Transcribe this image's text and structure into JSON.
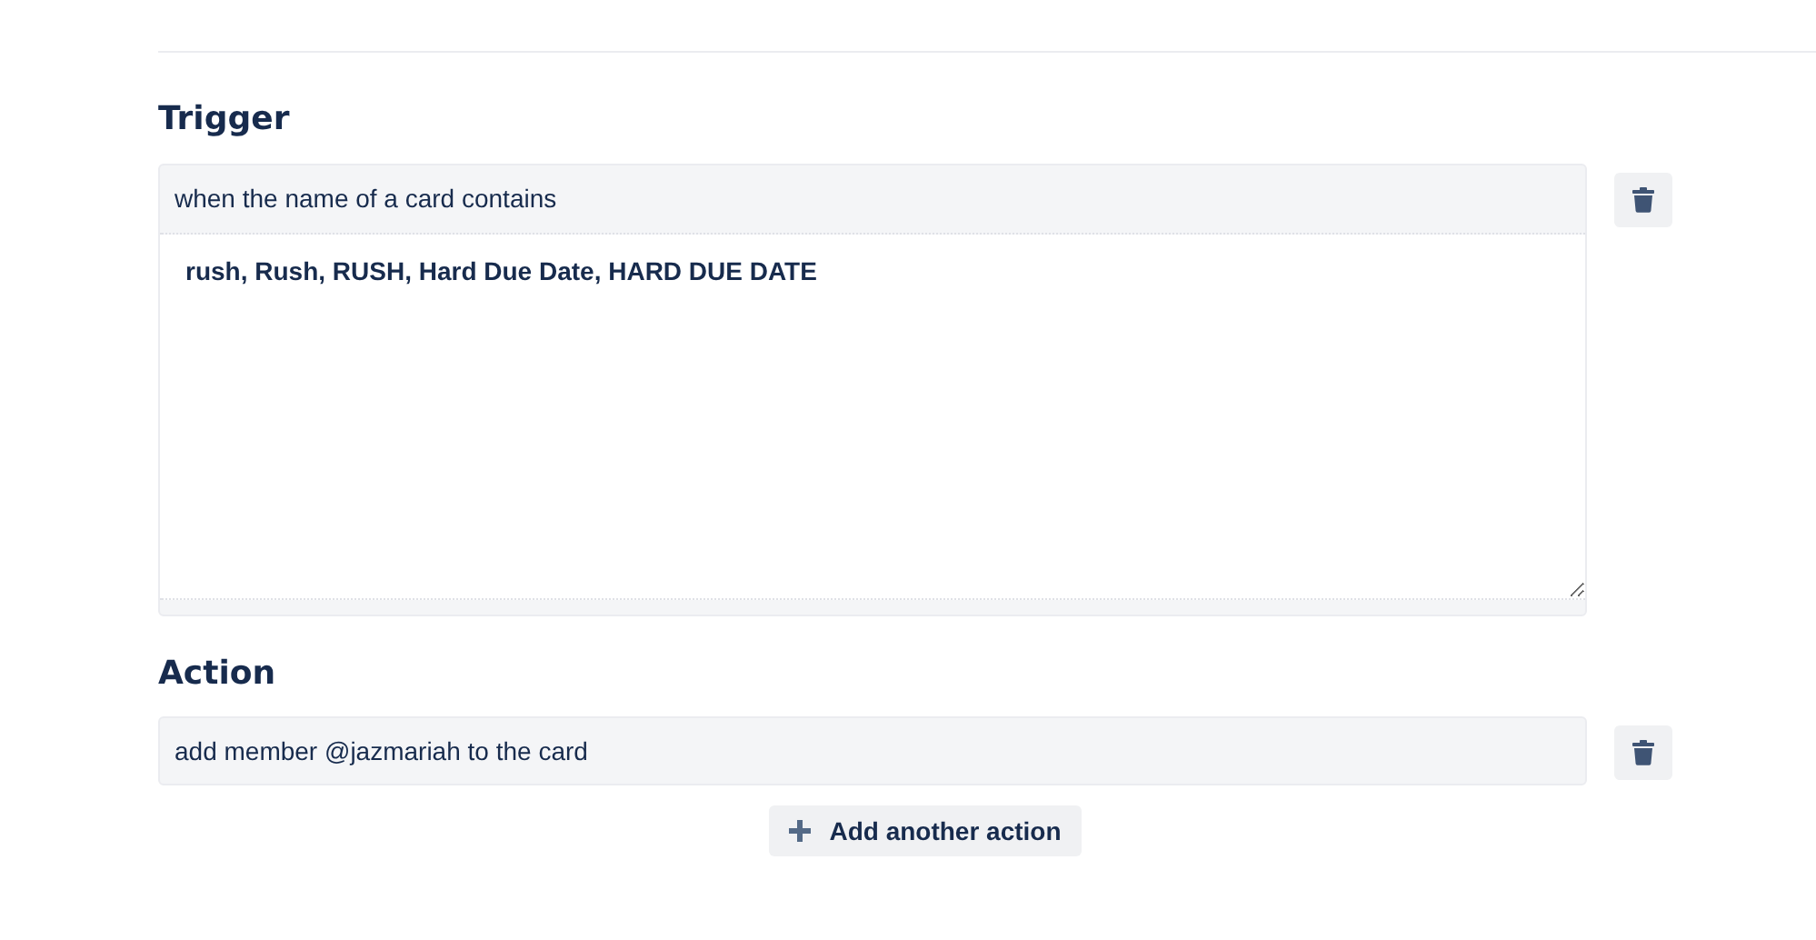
{
  "trigger": {
    "heading": "Trigger",
    "label": "when the name of a card contains",
    "value": "rush, Rush, RUSH, Hard Due Date, HARD DUE DATE"
  },
  "actions": [
    {
      "value": "add member @jazmariah to the card"
    }
  ],
  "action_heading": "Action",
  "add_button": {
    "label": "Add another action"
  }
}
